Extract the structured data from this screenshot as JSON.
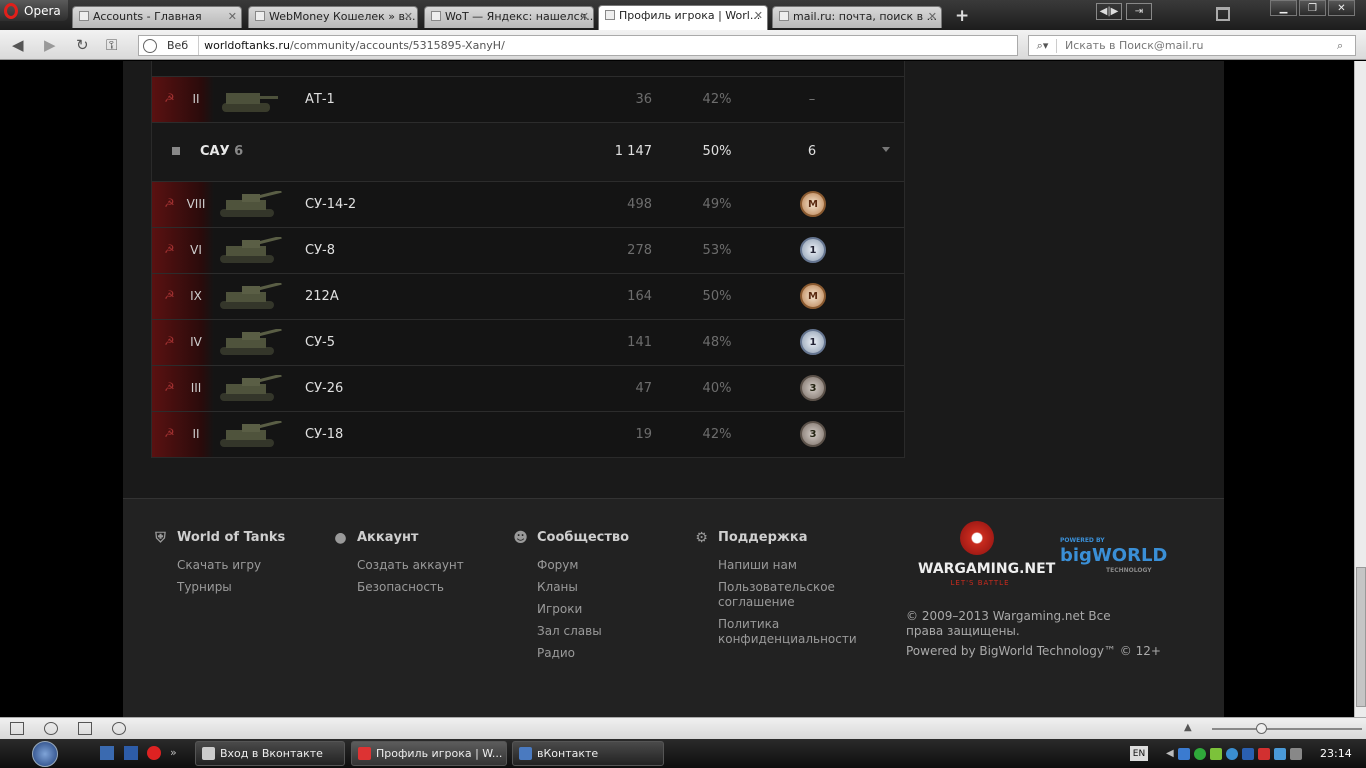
{
  "browser": {
    "menu_label": "Opera",
    "tabs": [
      {
        "label": "Accounts - Главная",
        "active": false
      },
      {
        "label": "WebMoney Кошелек » в...",
        "active": false
      },
      {
        "label": "WoT — Яндекс: нашелся...",
        "active": false
      },
      {
        "label": "Профиль игрока | Worl...",
        "active": true
      },
      {
        "label": "mail.ru: почта, поиск в ...",
        "active": false
      }
    ],
    "address": {
      "badge": "Веб",
      "host": "worldoftanks.ru",
      "path": "/community/accounts/5315895-XanyH/"
    },
    "search_placeholder": "Искать в Поиск@mail.ru"
  },
  "table": {
    "top_row": {
      "tier": "II",
      "name": "АТ-1",
      "battles": "36",
      "winrate": "42%",
      "mastery": "–"
    },
    "group": {
      "name": "САУ",
      "count": "6",
      "battles": "1 147",
      "winrate": "50%",
      "mastery": "6"
    },
    "rows": [
      {
        "tier": "VIII",
        "name": "СУ-14-2",
        "battles": "498",
        "winrate": "49%",
        "medal": "M",
        "medal_type": "m"
      },
      {
        "tier": "VI",
        "name": "СУ-8",
        "battles": "278",
        "winrate": "53%",
        "medal": "1",
        "medal_type": "c1"
      },
      {
        "tier": "IX",
        "name": "212А",
        "battles": "164",
        "winrate": "50%",
        "medal": "M",
        "medal_type": "m"
      },
      {
        "tier": "IV",
        "name": "СУ-5",
        "battles": "141",
        "winrate": "48%",
        "medal": "1",
        "medal_type": "c1"
      },
      {
        "tier": "III",
        "name": "СУ-26",
        "battles": "47",
        "winrate": "40%",
        "medal": "3",
        "medal_type": "c3"
      },
      {
        "tier": "II",
        "name": "СУ-18",
        "battles": "19",
        "winrate": "42%",
        "medal": "3",
        "medal_type": "c3"
      }
    ]
  },
  "footer": {
    "columns": [
      {
        "title": "World of Tanks",
        "icon": "shield-icon",
        "links": [
          "Скачать игру",
          "Турниры"
        ]
      },
      {
        "title": "Аккаунт",
        "icon": "user-icon",
        "links": [
          "Создать аккаунт",
          "Безопасность"
        ]
      },
      {
        "title": "Сообщество",
        "icon": "people-icon",
        "links": [
          "Форум",
          "Кланы",
          "Игроки",
          "Зал славы",
          "Радио"
        ]
      },
      {
        "title": "Поддержка",
        "icon": "gear-icon",
        "links": [
          "Напиши нам",
          "Пользовательское соглашение",
          "Политика конфиденциальности"
        ]
      }
    ],
    "wg_logo": "WARGAMING.NET",
    "wg_sub": "LET'S BATTLE",
    "bw_pre": "POWERED BY",
    "bw_logo": "bigWORLD",
    "bw_sub": "TECHNOLOGY",
    "copyright": "© 2009–2013 Wargaming.net Все права защищены.",
    "powered": "Powered by BigWorld Technology™ © 12+"
  },
  "taskbar": {
    "tasks": [
      {
        "label": "Вход в Вконтакте",
        "active": false
      },
      {
        "label": "Профиль игрока | W...",
        "active": true
      },
      {
        "label": "вКонтакте",
        "active": false
      }
    ],
    "lang": "EN",
    "clock": "23:14"
  }
}
